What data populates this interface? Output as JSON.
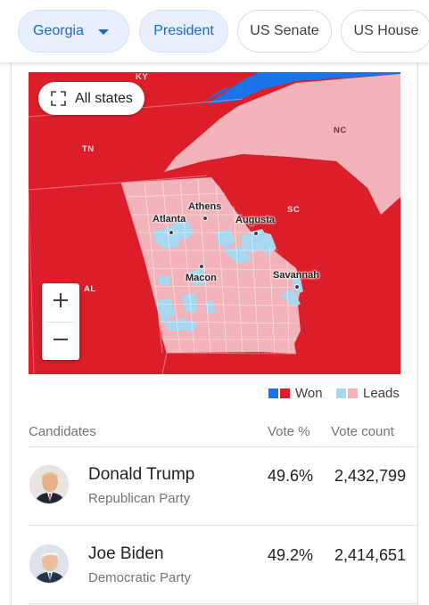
{
  "filters": {
    "state": "Georgia",
    "race_president": "President",
    "race_senate": "US Senate",
    "race_house": "US House"
  },
  "map": {
    "all_states_label": "All states",
    "state_labels": [
      "KY",
      "TN",
      "NC",
      "SC",
      "AL"
    ],
    "cities": [
      "Atlanta",
      "Athens",
      "Augusta",
      "Macon",
      "Savannah"
    ],
    "zoom_in": "+",
    "zoom_out": "−"
  },
  "legend": {
    "won_label": "Won",
    "leads_label": "Leads",
    "colors": {
      "dem_won": "#1a73e8",
      "rep_won": "#dc1e2a",
      "dem_leads": "#a8d8f0",
      "rep_leads": "#f2b3ba"
    }
  },
  "table": {
    "headers": {
      "candidates": "Candidates",
      "vote_pct": "Vote %",
      "vote_count": "Vote count"
    },
    "rows": [
      {
        "name": "Donald Trump",
        "party": "Republican Party",
        "pct": "49.6%",
        "count": "2,432,799"
      },
      {
        "name": "Joe Biden",
        "party": "Democratic Party",
        "pct": "49.2%",
        "count": "2,414,651"
      }
    ]
  }
}
